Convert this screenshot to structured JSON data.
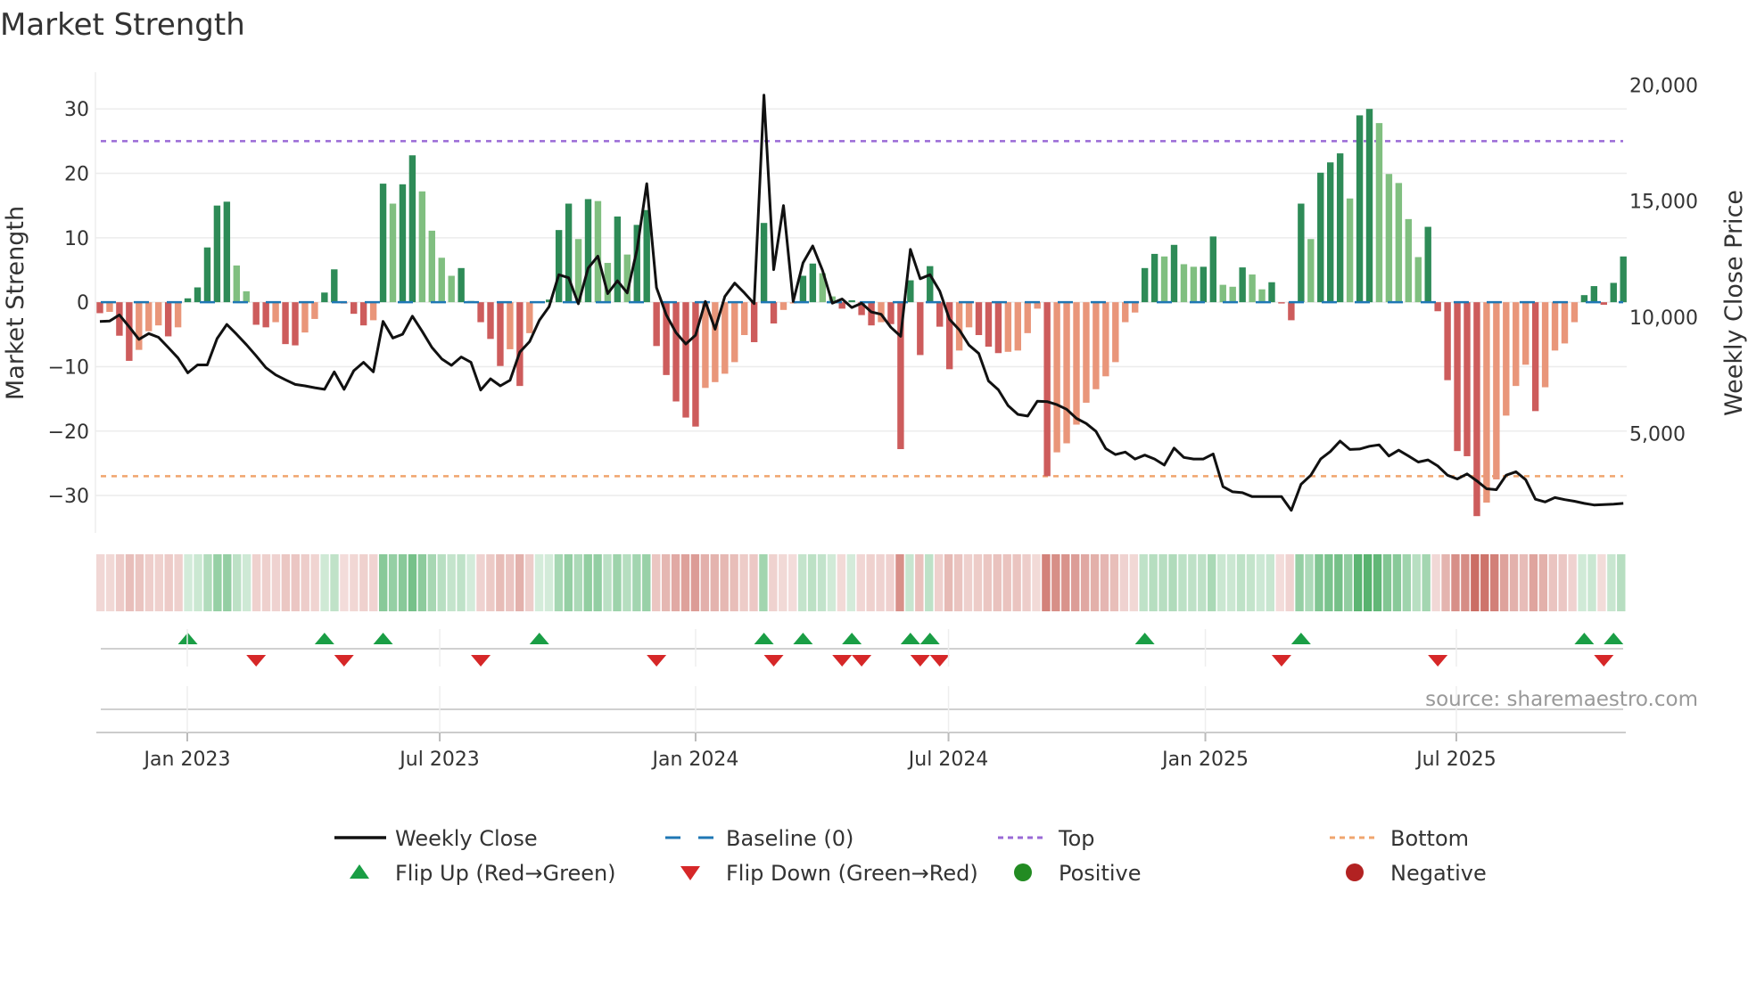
{
  "chart_data": {
    "type": "bar",
    "title": "Market Strength",
    "ylabel": "Market Strength",
    "y2label": "Weekly Close Price",
    "ylim": [
      -35.8,
      35.7
    ],
    "y2lim": [
      720,
      20550
    ],
    "yticks": [
      30,
      20,
      10,
      0,
      -10,
      -20,
      -30
    ],
    "yticklabels": [
      "30",
      "20",
      "10",
      "0",
      "−10",
      "−20",
      "−30"
    ],
    "y2ticks": [
      20000,
      15000,
      10000,
      5000
    ],
    "y2ticklabels": [
      "20,000",
      "15,000",
      "10,000",
      "5,000"
    ],
    "xticks": [
      {
        "label": "Jan 2023",
        "week": 9.95
      },
      {
        "label": "Jul 2023",
        "week": 35.8
      },
      {
        "label": "Jan 2024",
        "week": 62.0
      },
      {
        "label": "Jul 2024",
        "week": 87.9
      },
      {
        "label": "Jan 2025",
        "week": 114.2
      },
      {
        "label": "Jul 2025",
        "week": 139.9
      }
    ],
    "top_level": 25,
    "bottom_level": -27,
    "baseline": 0,
    "grid": true,
    "legend_position": "bottom",
    "strength": [
      -1.7,
      -1.5,
      -5.2,
      -9.1,
      -7.4,
      -4.5,
      -3.6,
      -5.3,
      -3.9,
      0.6,
      2.3,
      8.5,
      15.0,
      15.6,
      5.7,
      1.7,
      -3.5,
      -3.9,
      -3.1,
      -6.5,
      -6.7,
      -4.7,
      -2.6,
      1.5,
      5.1,
      -0.2,
      -1.8,
      -3.6,
      -2.8,
      18.4,
      15.3,
      18.3,
      22.8,
      17.2,
      11.1,
      6.9,
      4.1,
      5.3,
      0.2,
      -3.1,
      -5.7,
      -9.9,
      -7.3,
      -13.0,
      -4.8,
      0.1,
      0.4,
      11.2,
      15.3,
      9.8,
      16.0,
      15.7,
      6.1,
      13.3,
      7.4,
      12.0,
      14.3,
      -6.8,
      -11.3,
      -15.4,
      -17.9,
      -19.3,
      -13.3,
      -12.4,
      -11.1,
      -9.3,
      -5.1,
      -6.2,
      12.3,
      -3.3,
      -1.2,
      -0.2,
      4.1,
      6.0,
      4.5,
      0.9,
      -1.0,
      0.3,
      -2.0,
      -3.6,
      -3.1,
      -3.4,
      -22.8,
      3.4,
      -8.2,
      5.6,
      -3.8,
      -10.4,
      -7.5,
      -3.9,
      -5.1,
      -6.9,
      -7.9,
      -7.7,
      -7.5,
      -4.8,
      -1.0,
      -27.0,
      -23.3,
      -21.9,
      -19.0,
      -15.6,
      -13.5,
      -11.5,
      -9.3,
      -3.1,
      -1.6,
      5.3,
      7.5,
      7.1,
      8.9,
      5.9,
      5.5,
      5.5,
      10.2,
      2.7,
      2.4,
      5.4,
      4.3,
      2.0,
      3.1,
      -0.2,
      -2.8,
      15.3,
      9.8,
      20.1,
      21.7,
      23.1,
      16.1,
      29.0,
      30.0,
      27.8,
      19.9,
      18.5,
      12.9,
      7.0,
      11.7,
      -1.4,
      -12.1,
      -23.1,
      -23.9,
      -33.2,
      -31.1,
      -27.5,
      -17.6,
      -13.0,
      -9.7,
      -16.9,
      -13.2,
      -7.5,
      -6.4,
      -3.1,
      1.1,
      2.5,
      -0.4,
      3.0,
      7.1
    ],
    "weekly_close": [
      9820,
      9840,
      10100,
      9590,
      9050,
      9300,
      9140,
      8700,
      8250,
      7610,
      7950,
      7950,
      9080,
      9690,
      9270,
      8820,
      8340,
      7830,
      7520,
      7310,
      7110,
      7050,
      6970,
      6900,
      7650,
      6900,
      7700,
      8060,
      7650,
      9820,
      9110,
      9270,
      10050,
      9400,
      8700,
      8210,
      7930,
      8290,
      8060,
      6870,
      7350,
      7050,
      7290,
      8500,
      8950,
      9870,
      10460,
      11830,
      11700,
      10580,
      12120,
      12630,
      11020,
      11570,
      11050,
      12920,
      15750,
      11280,
      10100,
      9340,
      8850,
      9230,
      10680,
      9490,
      10900,
      11470,
      11050,
      10590,
      19560,
      12050,
      14810,
      10680,
      12340,
      13070,
      12020,
      10610,
      10790,
      10420,
      10610,
      10230,
      10130,
      9570,
      9180,
      12920,
      11660,
      11830,
      11130,
      9910,
      9460,
      8800,
      8440,
      7260,
      6880,
      6200,
      5820,
      5750,
      6390,
      6370,
      6240,
      6040,
      5650,
      5430,
      5090,
      4350,
      4090,
      4200,
      3900,
      4070,
      3900,
      3640,
      4370,
      3970,
      3900,
      3900,
      4120,
      2710,
      2490,
      2450,
      2280,
      2280,
      2280,
      2280,
      1690,
      2810,
      3200,
      3900,
      4220,
      4670,
      4310,
      4330,
      4450,
      4510,
      4030,
      4280,
      4030,
      3770,
      3860,
      3600,
      3200,
      3040,
      3260,
      2960,
      2620,
      2580,
      3200,
      3350,
      3010,
      2170,
      2050,
      2240,
      2150,
      2080,
      1990,
      1920,
      1940,
      1960,
      1990
    ],
    "legend": [
      {
        "label": "Weekly Close",
        "kind": "line"
      },
      {
        "label": "Baseline (0)",
        "kind": "dash"
      },
      {
        "label": "Top",
        "kind": "dot-purple"
      },
      {
        "label": "Bottom",
        "kind": "dot-orange"
      },
      {
        "label": "Flip Up (Red→Green)",
        "kind": "tri-up"
      },
      {
        "label": "Flip Down (Green→Red)",
        "kind": "tri-down"
      },
      {
        "label": "Positive",
        "kind": "circle-green"
      },
      {
        "label": "Negative",
        "kind": "circle-red"
      }
    ],
    "source": "source: sharemaestro.com"
  },
  "colors": {
    "pos_up": "#2e8b57",
    "pos_down": "#80bf80",
    "neg_down": "#cd5c5c",
    "neg_up": "#e9967a",
    "line": "#111111",
    "baseline": "#1f77b4",
    "top": "#9a6ad6",
    "bottom": "#f0a56e",
    "flip_up": "#1a9e45",
    "flip_down": "#d62728",
    "positive": "#228b22",
    "negative": "#b22222",
    "heat_green": "#3fa85a",
    "heat_red": "#c8645a"
  }
}
